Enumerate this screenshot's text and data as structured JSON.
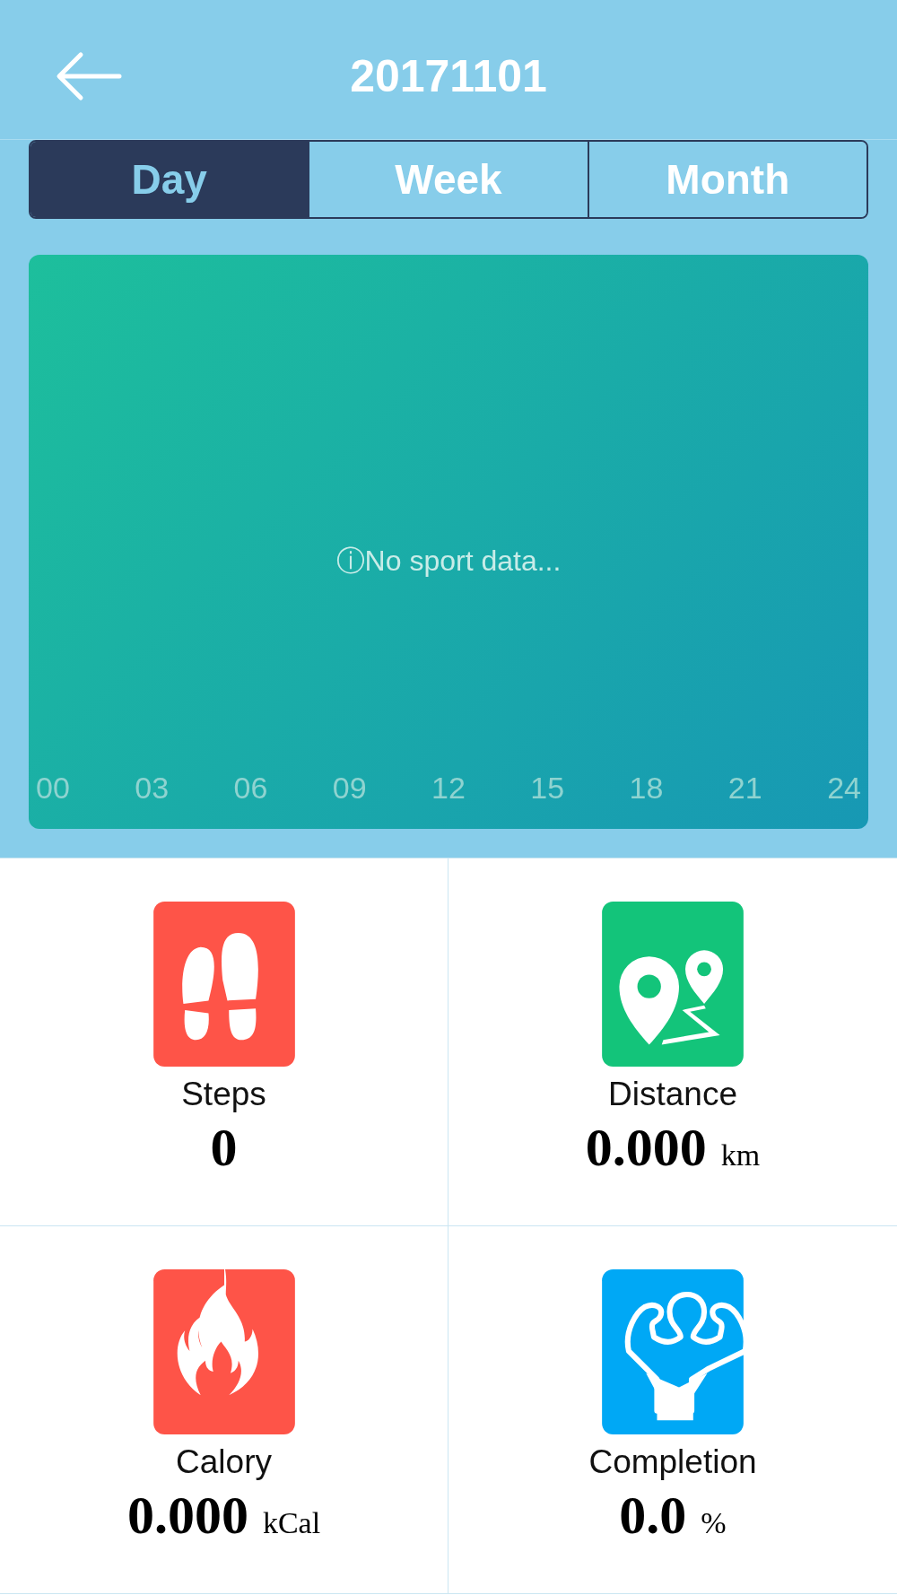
{
  "header": {
    "title": "20171101"
  },
  "tabs": [
    {
      "label": "Day",
      "selected": true
    },
    {
      "label": "Week",
      "selected": false
    },
    {
      "label": "Month",
      "selected": false
    }
  ],
  "chart": {
    "message": "ⓘNo sport data...",
    "x_labels": [
      "00",
      "03",
      "06",
      "09",
      "12",
      "15",
      "18",
      "21",
      "24"
    ]
  },
  "stats": [
    {
      "kind": "steps",
      "label": "Steps",
      "value": "0",
      "color": "#fe5448"
    },
    {
      "kind": "distance",
      "label": "Distance",
      "value": "0.000",
      "unit": "km",
      "color": "#13c47a"
    },
    {
      "kind": "calory",
      "label": "Calory",
      "value": "0.000",
      "unit": "kCal",
      "color": "#fe5448"
    },
    {
      "kind": "completion",
      "label": "Completion",
      "value": "0.0",
      "unit": "%",
      "color": "#00a8f5"
    }
  ]
}
